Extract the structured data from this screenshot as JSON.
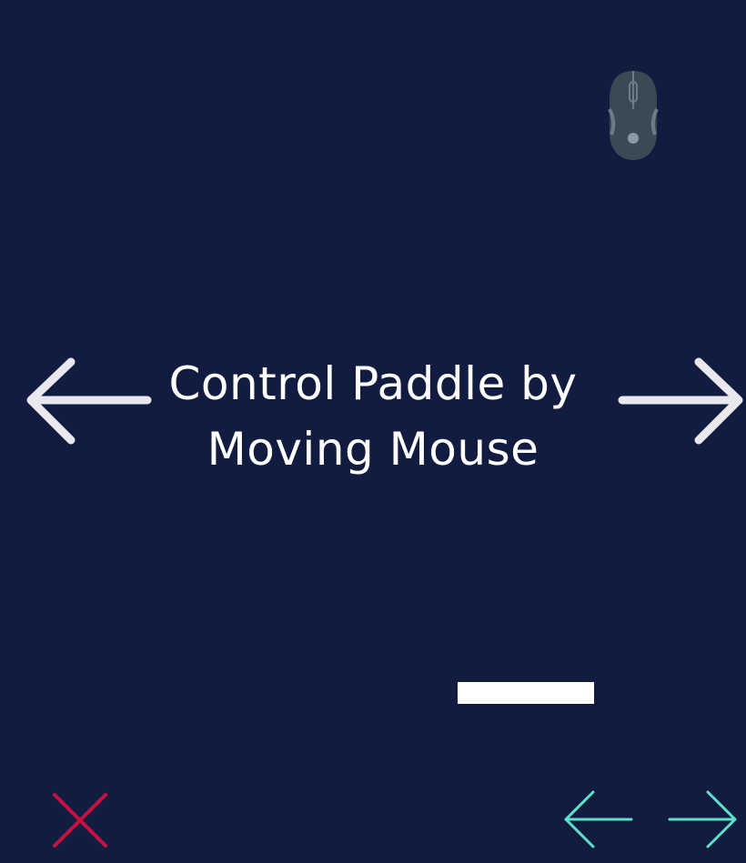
{
  "instruction": {
    "line1": "Control Paddle by",
    "line2": "Moving Mouse"
  },
  "icons": {
    "mouse": "mouse-icon",
    "big_left": "arrow-left-icon",
    "big_right": "arrow-right-icon",
    "close": "close-icon",
    "prev": "arrow-left-icon",
    "next": "arrow-right-icon"
  },
  "colors": {
    "background": "#111c40",
    "text": "#ffffff",
    "arrow": "#e8e8ee",
    "paddle": "#ffffff",
    "close": "#c8103e",
    "nav": "#5fe0c8",
    "mouse_body": "#3a4a55",
    "mouse_detail": "#6b7c86"
  }
}
